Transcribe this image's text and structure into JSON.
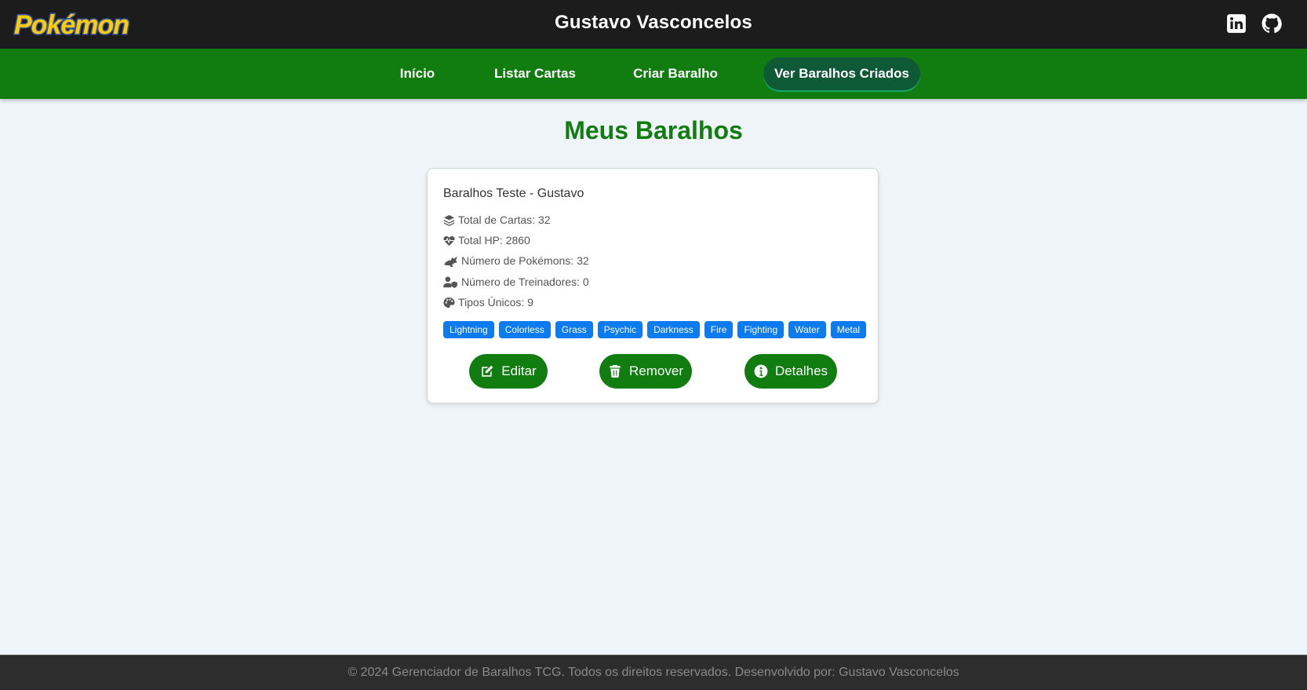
{
  "header": {
    "logo_text": "Pokémon",
    "title": "Gustavo Vasconcelos",
    "social_icons": [
      "linkedin-icon",
      "github-icon"
    ]
  },
  "nav": {
    "items": [
      {
        "label": "Início",
        "active": false
      },
      {
        "label": "Listar Cartas",
        "active": false
      },
      {
        "label": "Criar Baralho",
        "active": false
      },
      {
        "label": "Ver Baralhos Criados",
        "active": true
      }
    ]
  },
  "main": {
    "title": "Meus Baralhos",
    "deck": {
      "name": "Baralhos Teste - Gustavo",
      "stats": [
        {
          "icon": "layers-icon",
          "text": "Total de Cartas: 32"
        },
        {
          "icon": "heartbeat-icon",
          "text": "Total HP: 2860"
        },
        {
          "icon": "dragon-icon",
          "text": "Número de Pokémons: 32"
        },
        {
          "icon": "user-shield-icon",
          "text": "Número de Treinadores: 0"
        },
        {
          "icon": "palette-icon",
          "text": "Tipos Únicos: 9"
        }
      ],
      "types": [
        "Lightning",
        "Colorless",
        "Grass",
        "Psychic",
        "Darkness",
        "Fire",
        "Fighting",
        "Water",
        "Metal"
      ],
      "actions": {
        "edit": "Editar",
        "remove": "Remover",
        "details": "Detalhes"
      }
    }
  },
  "footer": {
    "text": "© 2024 Gerenciador de Baralhos TCG. Todos os direitos reservados. Desenvolvido por: Gustavo Vasconcelos"
  },
  "colors": {
    "header_bg": "#1c1c1c",
    "nav_bg": "#117d11",
    "nav_active_bg": "#0f5a36",
    "title_green": "#117d11",
    "tag_blue": "#0d7bf0",
    "button_green": "#117d11",
    "footer_bg": "#2d2d2d"
  }
}
